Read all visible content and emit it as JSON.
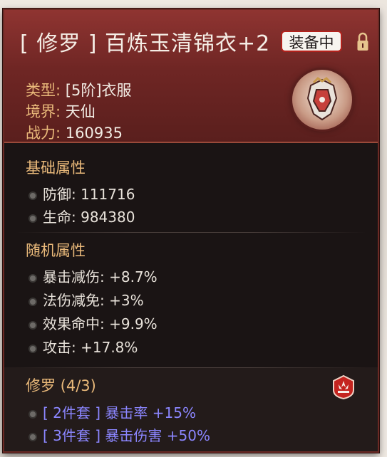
{
  "item": {
    "title": "[ 修罗 ] 百炼玉清锦衣+2",
    "equip_status": "装备中",
    "type_label": "类型:",
    "type_value": "[5阶]衣服",
    "realm_label": "境界:",
    "realm_value": "天仙",
    "power_label": "战力:",
    "power_value": "160935"
  },
  "base_attrs": {
    "title": "基础属性",
    "items": [
      {
        "label": "防御:",
        "value": "111716"
      },
      {
        "label": "生命:",
        "value": "984380"
      }
    ]
  },
  "random_attrs": {
    "title": "随机属性",
    "items": [
      {
        "label": "暴击减伤:",
        "value": "+8.7%"
      },
      {
        "label": "法伤减免:",
        "value": "+3%"
      },
      {
        "label": "效果命中:",
        "value": "+9.9%"
      },
      {
        "label": "攻击:",
        "value": "+17.8%"
      }
    ]
  },
  "set_bonus": {
    "title": "修罗 (4/3)",
    "items": [
      {
        "text": "[ 2件套 ] 暴击率 +15%"
      },
      {
        "text": "[ 3件套 ] 暴击伤害 +50%"
      }
    ]
  },
  "colors": {
    "header": "#8f3431",
    "label_gold": "#e9b97a",
    "set_purple": "#8b86ff",
    "badge_red": "#b3221c"
  },
  "icons": [
    "lock-icon",
    "equipment-icon",
    "bullet-icon",
    "set-emblem-icon"
  ]
}
